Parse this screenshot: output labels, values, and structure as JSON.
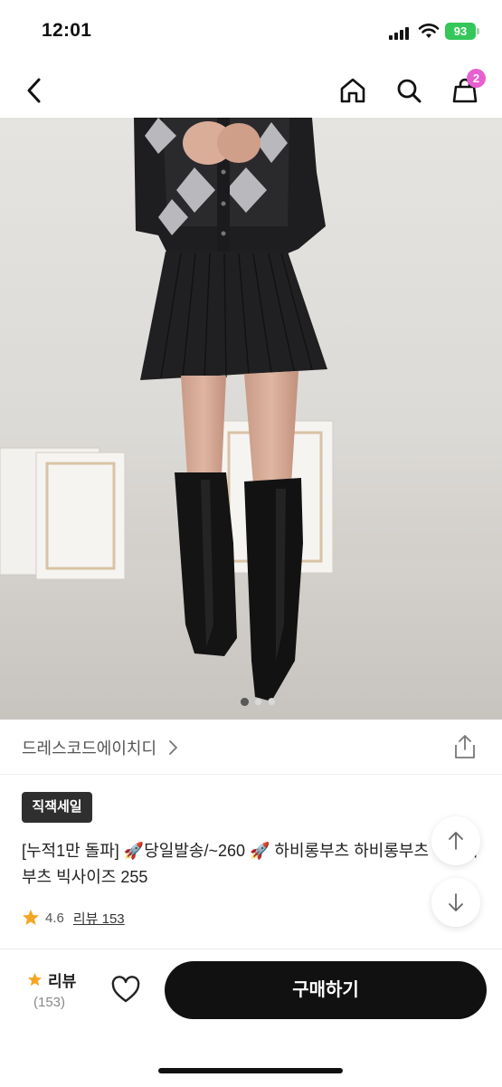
{
  "status_bar": {
    "time": "12:01",
    "battery": "93"
  },
  "header": {
    "cart_count": "2"
  },
  "carousel": {
    "pages": 3,
    "active_index": 0
  },
  "store": {
    "name": "드레스코드에이치디"
  },
  "product": {
    "badge": "직잭세일",
    "title": "[누적1만 돌파] 🚀당일발송/~260 🚀 하비롱부츠 하비롱부츠 니하이부츠 빅사이즈 255",
    "rating": "4.6",
    "review_link": "리뷰 153"
  },
  "bottom_bar": {
    "review_label": "리뷰",
    "review_count": "(153)",
    "buy_label": "구매하기"
  },
  "colors": {
    "badge_pink": "#e85fd1",
    "star": "#f5a623",
    "buy_button": "#111111"
  }
}
